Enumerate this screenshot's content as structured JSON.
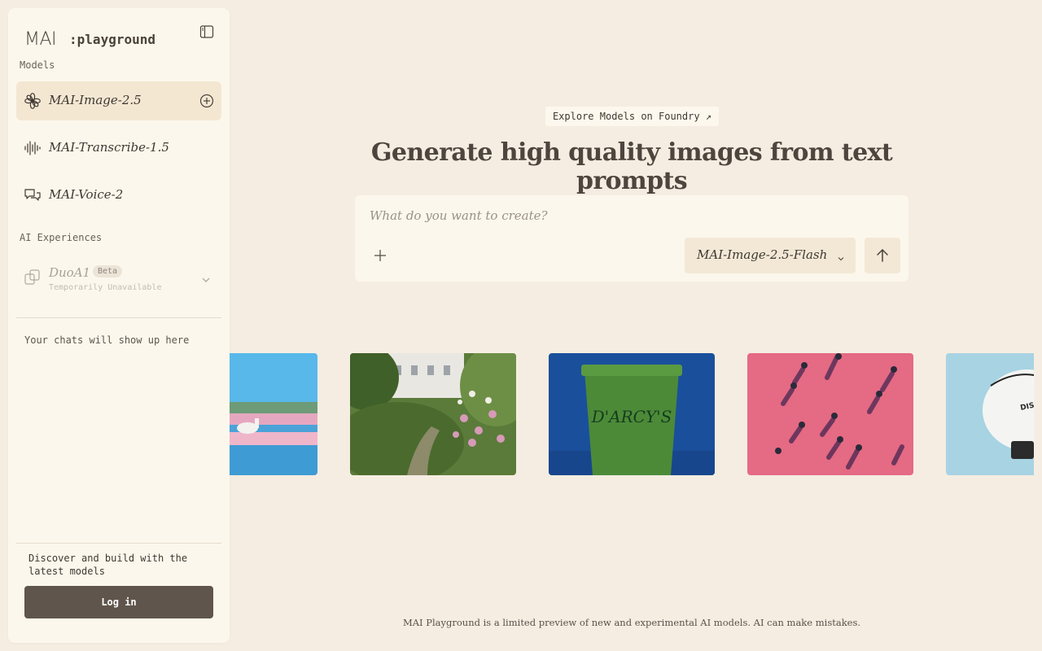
{
  "brand": {
    "logo": "MAI",
    "sub": ":playground"
  },
  "sidebar": {
    "models_label": "Models",
    "models": [
      {
        "label": "MAI-Image-2.5",
        "icon": "flower-icon",
        "active": true
      },
      {
        "label": "MAI-Transcribe-1.5",
        "icon": "waveform-icon",
        "active": false
      },
      {
        "label": "MAI-Voice-2",
        "icon": "chat-bubbles-icon",
        "active": false
      }
    ],
    "experiences_label": "AI Experiences",
    "duo": {
      "label": "DuoA1",
      "badge": "Beta",
      "status": "Temporarily Unavailable"
    },
    "empty_chats": "Your chats will show up here",
    "discover": "Discover and build with the latest models",
    "login": "Log in"
  },
  "main": {
    "explore_link": "Explore Models on Foundry ↗",
    "headline": "Generate high quality images from text prompts",
    "prompt_placeholder": "What do you want to create?",
    "selected_model": "MAI-Image-2.5-Flash",
    "gallery": [
      {
        "name": "pink-flower-lake-image"
      },
      {
        "name": "garden-path-image"
      },
      {
        "name": "green-ice-cream-tub-image",
        "text": "D'ARCY'S"
      },
      {
        "name": "aerial-people-pink-ground-image"
      },
      {
        "name": "white-cap-image",
        "text": "DISCO RUN CLUB"
      }
    ],
    "footer": "MAI Playground is a limited preview of new and experimental AI models. AI can make mistakes."
  },
  "colors": {
    "background": "#f5ede1",
    "panel": "#fcf7ec",
    "active": "#f4e7d2",
    "button_dark": "#5f554c"
  }
}
